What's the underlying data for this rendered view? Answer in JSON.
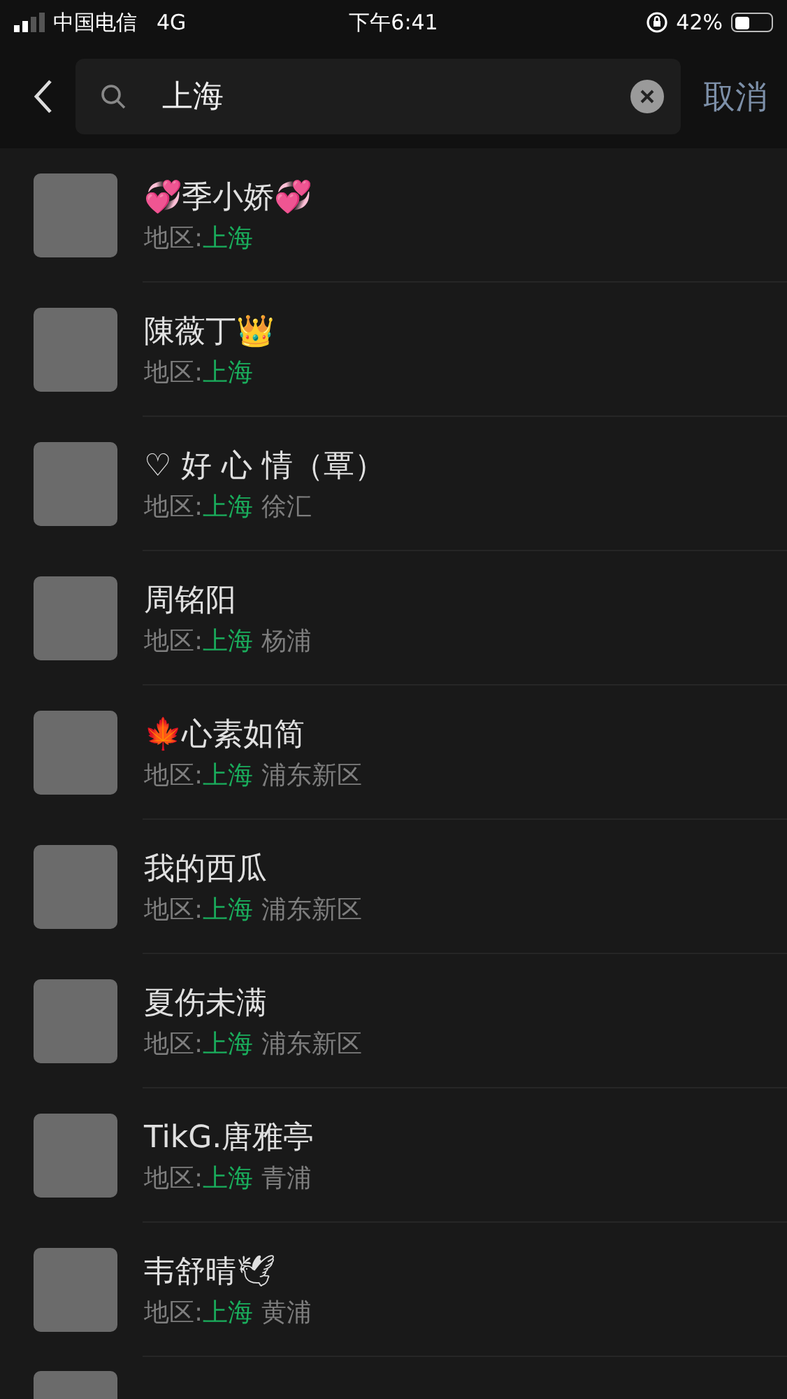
{
  "status_bar": {
    "carrier": "中国电信",
    "network": "4G",
    "time": "下午6:41",
    "battery": "42%"
  },
  "search": {
    "value": "上海",
    "cancel": "取消"
  },
  "results": [
    {
      "name": "💞季小娇💞",
      "region_label": "地区:",
      "province": "上海"
    },
    {
      "name": "陳薇丁👑",
      "region_label": "地区:",
      "province": "上海"
    },
    {
      "name": "♡ 好 心 情（覃）",
      "region_label": "地区:",
      "province": "上海",
      "district": "徐汇"
    },
    {
      "name": "周铭阳",
      "region_label": "地区:",
      "province": "上海",
      "district": "杨浦"
    },
    {
      "name": "🍁心素如简",
      "region_label": "地区:",
      "province": "上海",
      "district": "浦东新区"
    },
    {
      "name": "我的西瓜",
      "region_label": "地区:",
      "province": "上海",
      "district": "浦东新区"
    },
    {
      "name": "夏伤未满",
      "region_label": "地区:",
      "province": "上海",
      "district": "浦东新区"
    },
    {
      "name": "TikG.唐雅亭",
      "region_label": "地区:",
      "province": "上海",
      "district": "青浦"
    },
    {
      "name": "韦舒晴🕊",
      "region_label": "地区:",
      "province": "上海",
      "district": "黄浦"
    }
  ]
}
